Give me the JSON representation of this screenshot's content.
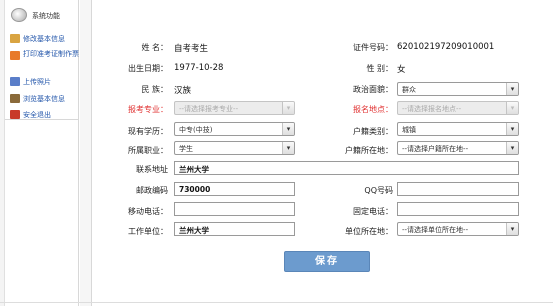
{
  "sidebar": {
    "title": "系统功能",
    "items": [
      {
        "label": "修改基本信息",
        "icon": "edit-icon",
        "color": "#d9a441"
      },
      {
        "label": "打印准考证制作票",
        "icon": "print-icon",
        "color": "#e87a2a"
      },
      {
        "label": "上传照片",
        "icon": "photo-icon",
        "color": "#5a7ec9"
      },
      {
        "label": "浏览基本信息",
        "icon": "book-icon",
        "color": "#8a6a3a"
      },
      {
        "label": "安全退出",
        "icon": "exit-icon",
        "color": "#c83a2a"
      }
    ]
  },
  "form": {
    "name": {
      "label": "姓 名：",
      "value": "自考考生"
    },
    "id_number": {
      "label": "证件号码：",
      "value": "620102197209010001"
    },
    "birth": {
      "label": "出生日期：",
      "value": "1977-10-28"
    },
    "gender": {
      "label": "性 别：",
      "value": "女"
    },
    "ethnicity": {
      "label": "民 族：",
      "value": "汉族"
    },
    "political": {
      "label": "政治面貌：",
      "value": "群众"
    },
    "major": {
      "label": "报考专业：",
      "value": "--请选择报考专业--"
    },
    "exam_site": {
      "label": "报名地点：",
      "value": "--请选择报名地点--"
    },
    "education": {
      "label": "现有学历：",
      "value": "中专(中技)"
    },
    "household_type": {
      "label": "户籍类别：",
      "value": "城镇"
    },
    "occupation": {
      "label": "所属职业：",
      "value": "学生"
    },
    "household_location": {
      "label": "户籍所在地：",
      "value": "--请选择户籍所在地--"
    },
    "address": {
      "label": "联系地址",
      "value": "兰州大学"
    },
    "postcode": {
      "label": "邮政编码",
      "value": "730000"
    },
    "qq": {
      "label": "QQ号码",
      "value": ""
    },
    "mobile": {
      "label": "移动电话：",
      "value": ""
    },
    "landline": {
      "label": "固定电话：",
      "value": ""
    },
    "employer": {
      "label": "工作单位：",
      "value": "兰州大学"
    },
    "employer_location": {
      "label": "单位所在地：",
      "value": "--请选择单位所在地--"
    },
    "save_label": "保存",
    "dropdown_arrow": "▾"
  },
  "colors": {
    "required_label": "#e03030",
    "save_button": "#6c9bce",
    "link": "#2255aa"
  }
}
